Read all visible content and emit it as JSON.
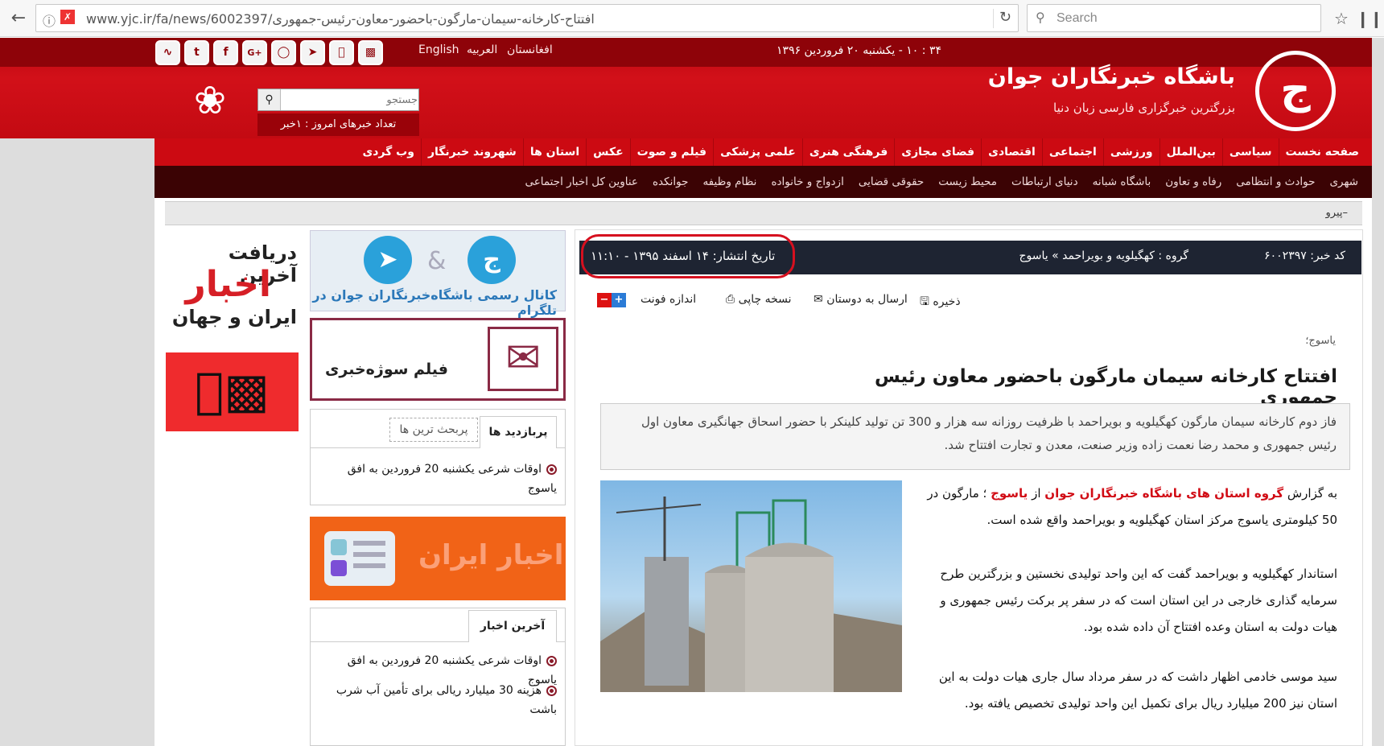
{
  "browser": {
    "url": "www.yjc.ir/fa/news/6002397/افتتاح-کارخانه-سیمان-مارگون-باحضور-معاون-رئیس-جمهوری",
    "search_placeholder": "Search"
  },
  "header": {
    "datetime": "۳۴ : ۱۰ - یکشنبه ۲۰ فروردین ۱۳۹۶",
    "site_title": "باشگاه خبرنگاران جوان",
    "site_subtitle": "بزرگترین خبرگزاری فارسی زبان دنیا",
    "languages": [
      "افغانستان",
      "العربیه",
      "English"
    ],
    "search_placeholder": "جستجو",
    "news_count": "تعداد خبرهای امروز : ۱خبر"
  },
  "main_nav": [
    "صفحه نخست",
    "سیاسی",
    "بین‌الملل",
    "ورزشی",
    "اجتماعی",
    "اقتصادی",
    "فضای مجازی",
    "فرهنگی هنری",
    "علمی پزشکی",
    "فیلم و صوت",
    "عکس",
    "استان ها",
    "شهروند خبرنگار",
    "وب گردی"
  ],
  "sub_nav": [
    "شهری",
    "حوادث و انتظامی",
    "رفاه و تعاون",
    "باشگاه شبانه",
    "دنیای ارتباطات",
    "محیط زیست",
    "حقوقی قضایی",
    "ازدواج و خانواده",
    "نظام وظیفه",
    "جوانکده",
    "عناوین کل اخبار اجتماعی"
  ],
  "breadcrumb": "پیرو–",
  "article": {
    "news_code": "کد خبر: ۶۰۰۲۳۹۷",
    "group": "گروه : کهگیلویه و بویراحمد » یاسوج",
    "pub_date": "تاریخ انتشار: ۱۴ اسفند ۱۳۹۵ - ۱۱:۱۰",
    "tools": {
      "save": "ذخیره",
      "send": "ارسال به دوستان",
      "print": "نسخه چاپی",
      "font": "اندازه فونت"
    },
    "location": "یاسوج؛",
    "headline": "افتتاح کارخانه سیمان مارگون باحضور معاون رئیس جمهوری",
    "lead": "فاز دوم کارخانه سیمان مارگون کهگیلویه و بویراحمد با ظرفیت روزانه سه هزار و 300 تن تولید کلینکر با حضور اسحاق جهانگیری معاون اول رئیس جمهوری و محمد رضا نعمت زاده وزیر صنعت، معدن و تجارت افتتاح شد.",
    "p1_a": "به گزارش",
    "p1_red1": "گروه استان های باشگاه خبرنگاران جوان",
    "p1_b": "از",
    "p1_red2": "یاسوج",
    "p1_c": "؛ مارگون در 50 کیلومتری یاسوج مرکز استان کهگیلویه و بویراحمد واقع شده است.",
    "p2": "استاندار کهگیلویه و بویراحمد گفت که این واحد تولیدی نخستین و بزرگترین طرح سرمایه گذاری خارجی در این استان است که در سفر پر برکت رئیس جمهوری و هیات دولت به استان وعده افتتاح آن داده شده بود.",
    "p3": "سید موسی خادمی اظهار داشت که در سفر مرداد سال جاری هیات دولت به این استان نیز 200 میلیارد ریال برای تکمیل این واحد تولیدی تخصیص یافته بود."
  },
  "sidebar": {
    "telegram_text": "کانال رسمی باشگاه‌خبرنگاران جوان در تلگرام",
    "film_text": "فیلم سوژه‌خبری",
    "popular_tab1": "پربازدید ها",
    "popular_tab2": "پربحث ترین ها",
    "popular_items": [
      "اوقات شرعی یکشنبه 20 فروردین به افق یاسوج"
    ],
    "iran_text": "اخبار ایران",
    "latest_tab": "آخرین اخبار",
    "latest_items": [
      "اوقات شرعی یکشنبه 20 فروردین به افق یاسوج",
      "هزینه 30 میلیارد ریالی برای تأمین آب شرب باشت"
    ],
    "app_line1": "دریافت آخرین",
    "app_line2": "اخبار",
    "app_line3": "ایران و جهان"
  }
}
